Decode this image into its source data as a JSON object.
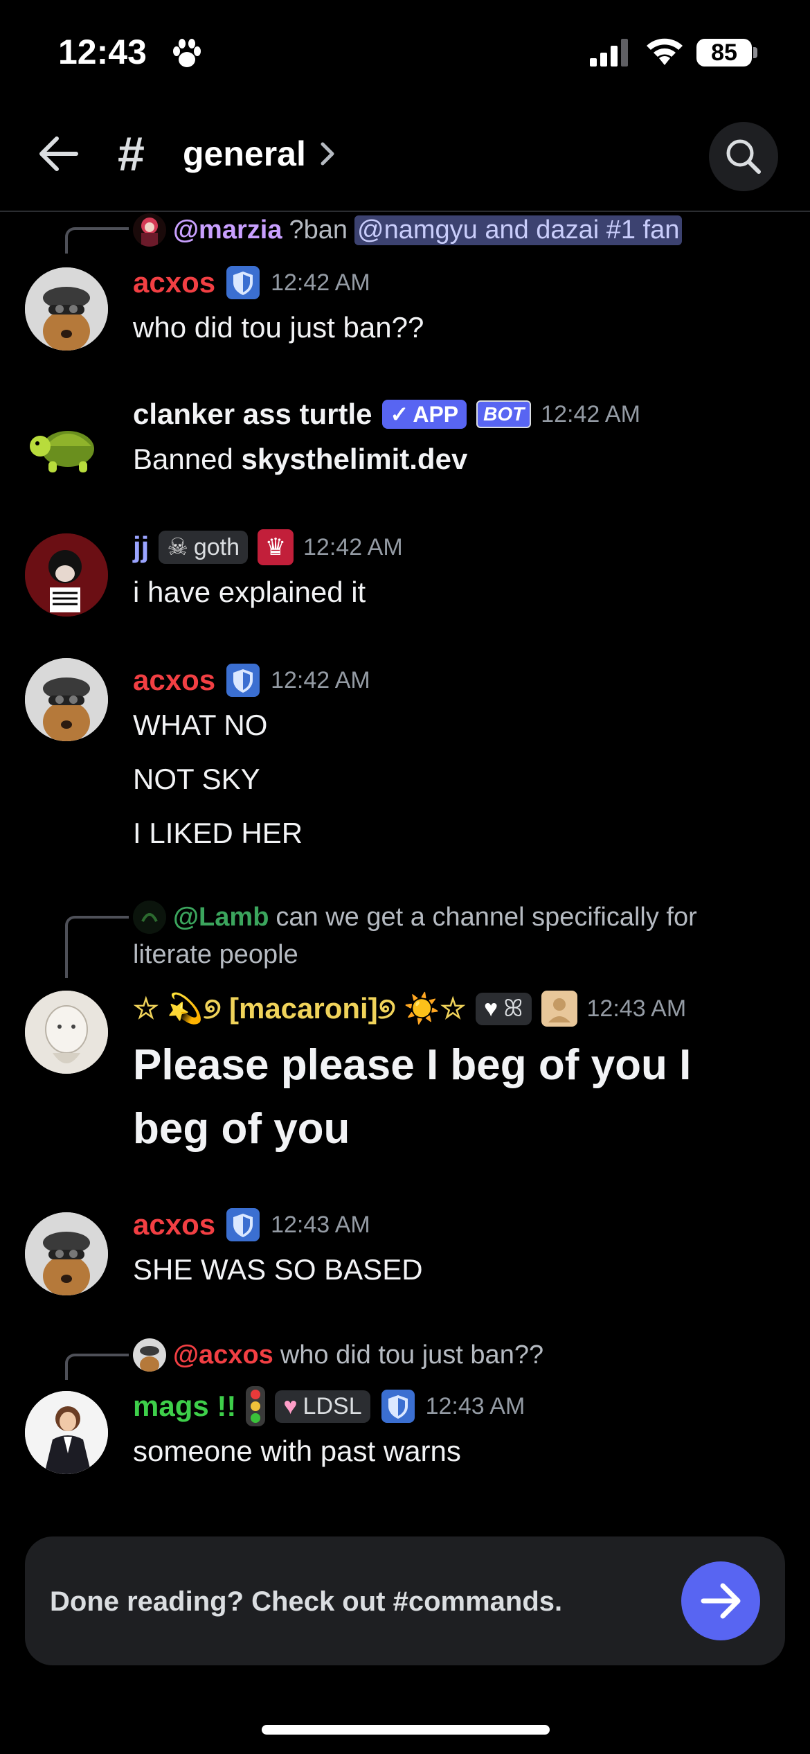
{
  "status_bar": {
    "time": "12:43",
    "battery": "85",
    "icons": [
      "paw-icon",
      "signal-icon",
      "wifi-icon",
      "battery-icon"
    ]
  },
  "header": {
    "channel_hash": "#",
    "channel_name": "general",
    "icons": [
      "back-arrow-icon",
      "chevron-right-icon",
      "search-icon"
    ]
  },
  "messages": [
    {
      "reply": {
        "author": "@marzia",
        "text": "?ban",
        "mention": "@namgyu and dazai #1 fan"
      },
      "author": "acxos",
      "author_color": "#f23f43",
      "timestamp": "12:42 AM",
      "lines": [
        "who did tou just ban??"
      ]
    },
    {
      "author": "clanker ass turtle",
      "author_color": "#f2f3f5",
      "app_tag": "APP",
      "bot_tag": "BOT",
      "timestamp": "12:42 AM",
      "text_prefix": "Banned",
      "text_bold": "skysthelimit.dev"
    },
    {
      "author": "jj",
      "author_color": "#9aa4ff",
      "role": "goth",
      "timestamp": "12:42 AM",
      "lines": [
        "i have explained it"
      ]
    },
    {
      "author": "acxos",
      "author_color": "#f23f43",
      "timestamp": "12:42 AM",
      "lines": [
        "WHAT NO",
        "NOT SKY",
        "I LIKED HER"
      ]
    },
    {
      "reply": {
        "author": "@Lamb",
        "author_color": "#3ba55d",
        "text": "can we get a channel specifically for",
        "text2": "literate people"
      },
      "author": "☆ 💫୭ [macaroni]୭ ☀️☆",
      "author_color": "#f0d35a",
      "role": "ꕤ",
      "timestamp": "12:43 AM",
      "lines": [
        "Please please I beg of you I",
        "beg of you"
      ]
    },
    {
      "author": "acxos",
      "author_color": "#f23f43",
      "timestamp": "12:43 AM",
      "lines": [
        "SHE WAS SO BASED"
      ]
    },
    {
      "reply": {
        "author": "@acxos",
        "author_color": "#f23f43",
        "text": "who did tou just ban??"
      },
      "author": "mags !!",
      "author_color": "#3ecf4a",
      "role": "LDSL",
      "timestamp": "12:43 AM",
      "lines": [
        "someone with past warns"
      ]
    }
  ],
  "input": {
    "placeholder": "Done reading? Check out #commands."
  },
  "colors": {
    "accent": "#5865f2",
    "background": "#000000"
  }
}
